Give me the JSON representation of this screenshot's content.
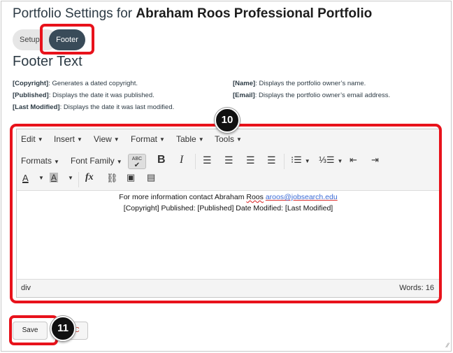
{
  "page": {
    "title_prefix": "Portfolio Settings for ",
    "title_name": "Abraham Roos Professional Portfolio"
  },
  "tabs": {
    "setup": "Setup",
    "footer": "Footer"
  },
  "section": {
    "heading": "Footer Text"
  },
  "descriptions": {
    "left": [
      {
        "key": "[Copyright]",
        "text": ": Generates a dated copyright."
      },
      {
        "key": "[Published]",
        "text": ": Displays the date it was published."
      },
      {
        "key": "[Last Modified]",
        "text": ": Displays the date it was last modified."
      }
    ],
    "right": [
      {
        "key": "[Name]",
        "text": ": Displays the portfolio owner’s name."
      },
      {
        "key": "[Email]",
        "text": ": Displays the portfolio owner’s email address."
      }
    ]
  },
  "editor": {
    "menu": [
      "Edit",
      "Insert",
      "View",
      "Format",
      "Table",
      "Tools"
    ],
    "formats_label": "Formats",
    "font_family_label": "Font Family",
    "spell_label": "ABC",
    "bold_label": "B",
    "italic_label": "I",
    "content": {
      "line1_prefix": "For more information contact Abraham ",
      "line1_name": "Roos",
      "line1_link": "aroos@jobsearch.edu",
      "line2": "[Copyright] Published: [Published] Date Modified: [Last Modified]"
    },
    "status_path": "div",
    "word_count": "Words: 16"
  },
  "badges": {
    "editor": "10",
    "save": "11"
  },
  "buttons": {
    "save": "Save",
    "cancel": "C"
  },
  "colors": {
    "highlight": "#e8121b",
    "active_tab": "#394b59"
  }
}
